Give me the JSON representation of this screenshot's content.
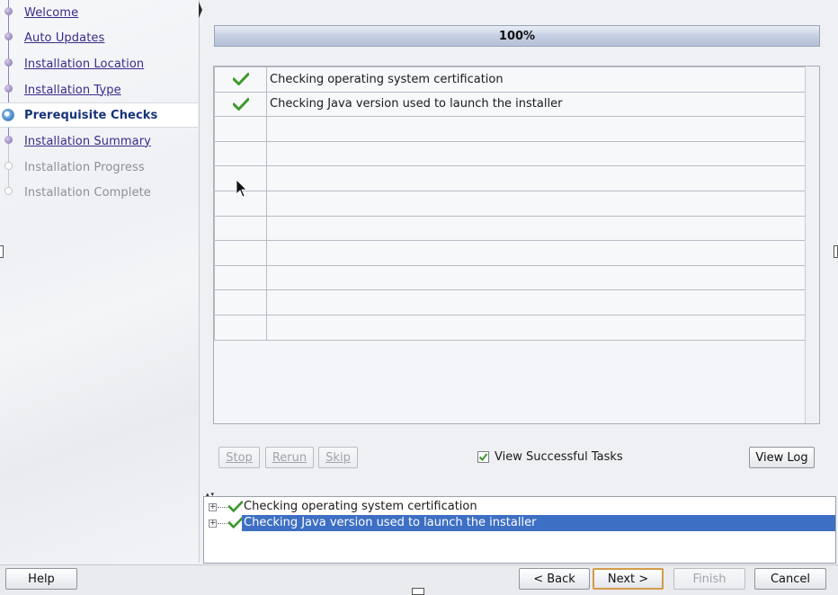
{
  "sidebar": {
    "items": [
      {
        "label": "Welcome",
        "state": "done"
      },
      {
        "label": "Auto Updates",
        "state": "done"
      },
      {
        "label": "Installation Location",
        "state": "done"
      },
      {
        "label": "Installation Type",
        "state": "done"
      },
      {
        "label": "Prerequisite Checks",
        "state": "current"
      },
      {
        "label": "Installation Summary",
        "state": "done"
      },
      {
        "label": "Installation Progress",
        "state": "future"
      },
      {
        "label": "Installation Complete",
        "state": "future"
      }
    ]
  },
  "progress": {
    "label": "100%",
    "value": 1.0
  },
  "tasks": {
    "rows": [
      {
        "status": "check-icon",
        "text": "Checking operating system certification"
      },
      {
        "status": "check-icon",
        "text": "Checking Java version used to launch the installer"
      }
    ],
    "empty_rows": 9
  },
  "actions": {
    "stop": "Stop",
    "rerun": "Rerun",
    "skip": "Skip",
    "view_successful": "View Successful Tasks",
    "view_successful_checked": true,
    "view_log": "View Log"
  },
  "detail_tree": {
    "items": [
      {
        "text": "Checking operating system certification",
        "selected": false
      },
      {
        "text": "Checking Java version used to launch the installer",
        "selected": true
      }
    ]
  },
  "footer": {
    "help": "Help",
    "back": "< Back",
    "next": "Next >",
    "finish": "Finish",
    "cancel": "Cancel"
  },
  "colors": {
    "nav_link": "#3a2a8a",
    "nav_current": "#16327a",
    "selection": "#3d6fc4",
    "check": "#3a9a2a",
    "default_button_border": "#d49a4a"
  }
}
